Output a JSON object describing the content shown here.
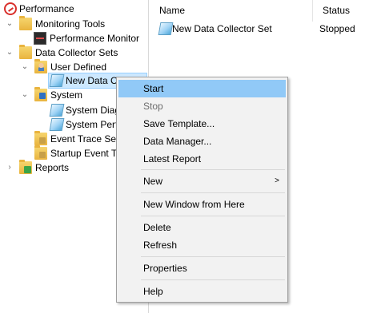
{
  "tree": {
    "root": "Performance",
    "monitoring_tools": "Monitoring Tools",
    "performance_monitor": "Performance Monitor",
    "data_collector_sets": "Data Collector Sets",
    "user_defined": "User Defined",
    "new_data_collector_truncated": "New Data C",
    "system": "System",
    "system_diag": "System Diag",
    "system_perf": "System Perf",
    "event_trace": "Event Trace Ses",
    "startup_event": "Startup Event Tr",
    "reports": "Reports"
  },
  "list": {
    "columns": [
      "Name",
      "Status"
    ],
    "rows": [
      {
        "name": "New Data Collector Set",
        "status": "Stopped"
      }
    ]
  },
  "context_menu": {
    "start": "Start",
    "stop": "Stop",
    "save_template": "Save Template...",
    "data_manager": "Data Manager...",
    "latest_report": "Latest Report",
    "new": "New",
    "new_window": "New Window from Here",
    "delete": "Delete",
    "refresh": "Refresh",
    "properties": "Properties",
    "help": "Help",
    "submenu_arrow": ">"
  },
  "icons": {
    "expanded": "chevron-down-icon",
    "collapsed": "chevron-right-icon",
    "folder": "folder-icon",
    "data_collector": "data-collector-set-icon"
  },
  "colors": {
    "menu_highlight": "#91c9f7",
    "tree_selection": "#cce8ff",
    "menu_background": "#f2f2f2",
    "disabled_text": "#6d6d6d"
  }
}
